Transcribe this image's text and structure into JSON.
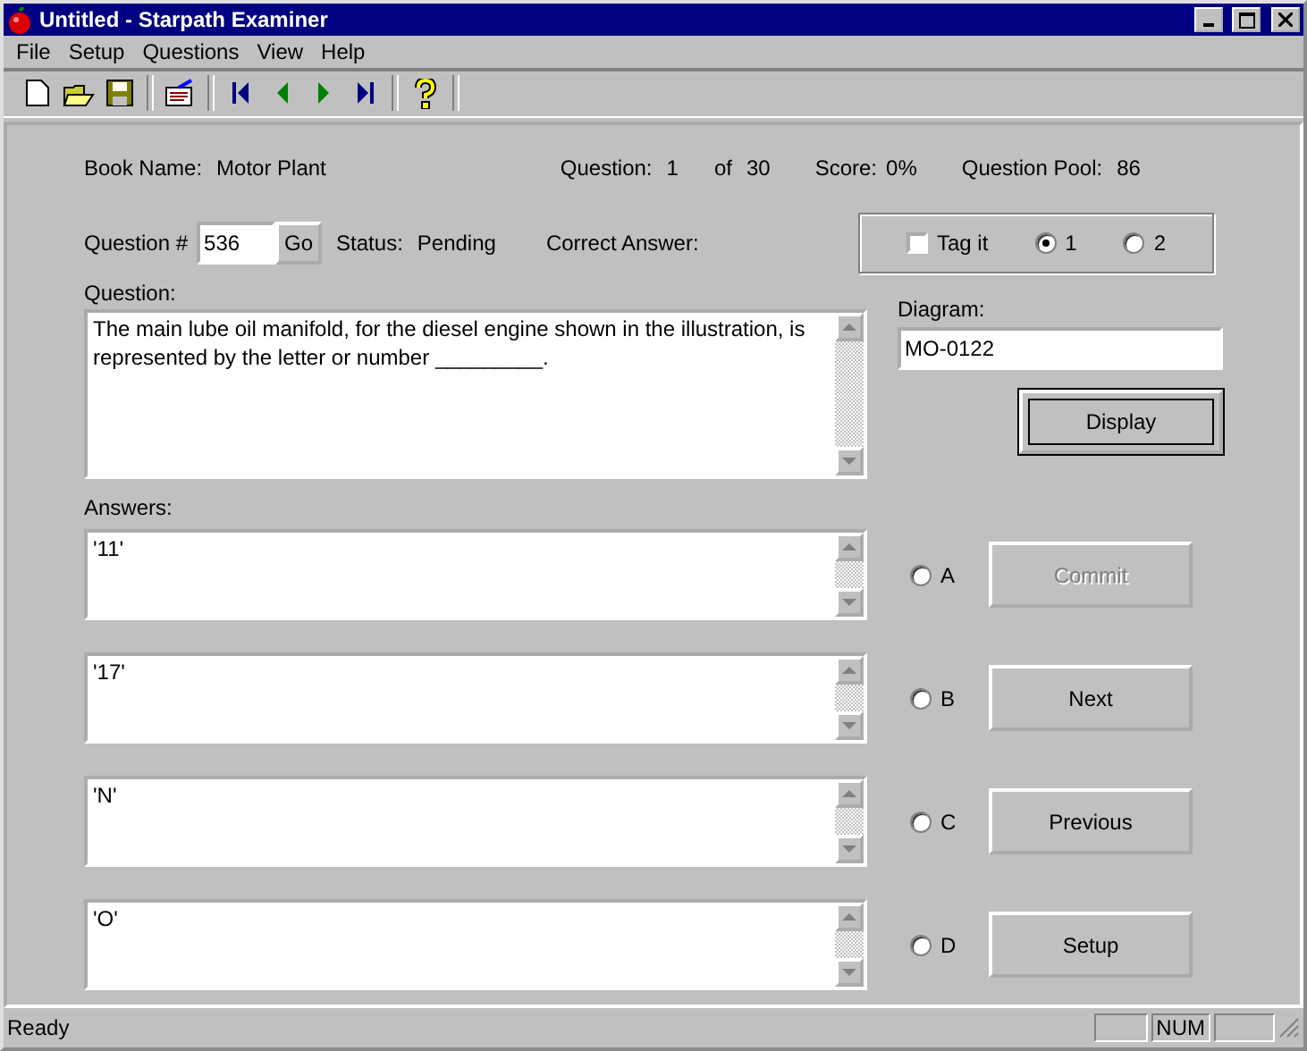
{
  "window": {
    "title": "Untitled - Starpath Examiner"
  },
  "menu": [
    "File",
    "Setup",
    "Questions",
    "View",
    "Help"
  ],
  "info": {
    "book_label": "Book Name:",
    "book": "Motor Plant",
    "question_label": "Question:",
    "question_no": "1",
    "of_label": "of",
    "question_total": "30",
    "score_label": "Score:",
    "score": "0%",
    "pool_label": "Question Pool:",
    "pool": "86"
  },
  "question_number": {
    "label": "Question #",
    "value": "536",
    "go": "Go",
    "status_label": "Status:",
    "status": "Pending",
    "correct_label": "Correct Answer:"
  },
  "tag": {
    "label": "Tag it",
    "checked": false,
    "options": [
      {
        "label": "1",
        "selected": true
      },
      {
        "label": "2",
        "selected": false
      }
    ]
  },
  "question": {
    "label": "Question:",
    "text": "The main lube oil manifold, for the diesel engine shown in the illustration, is represented by the letter or number _________."
  },
  "diagram": {
    "label": "Diagram:",
    "value": "MO-0122",
    "button": "Display"
  },
  "answers_label": "Answers:",
  "answers": [
    {
      "text": "'11'",
      "letter": "A",
      "selected": false,
      "button": "Commit",
      "disabled": true
    },
    {
      "text": "'17'",
      "letter": "B",
      "selected": false,
      "button": "Next",
      "disabled": false
    },
    {
      "text": "'N'",
      "letter": "C",
      "selected": false,
      "button": "Previous",
      "disabled": false
    },
    {
      "text": "'O'",
      "letter": "D",
      "selected": false,
      "button": "Setup",
      "disabled": false
    }
  ],
  "status_bar": {
    "text": "Ready",
    "num": "NUM"
  }
}
